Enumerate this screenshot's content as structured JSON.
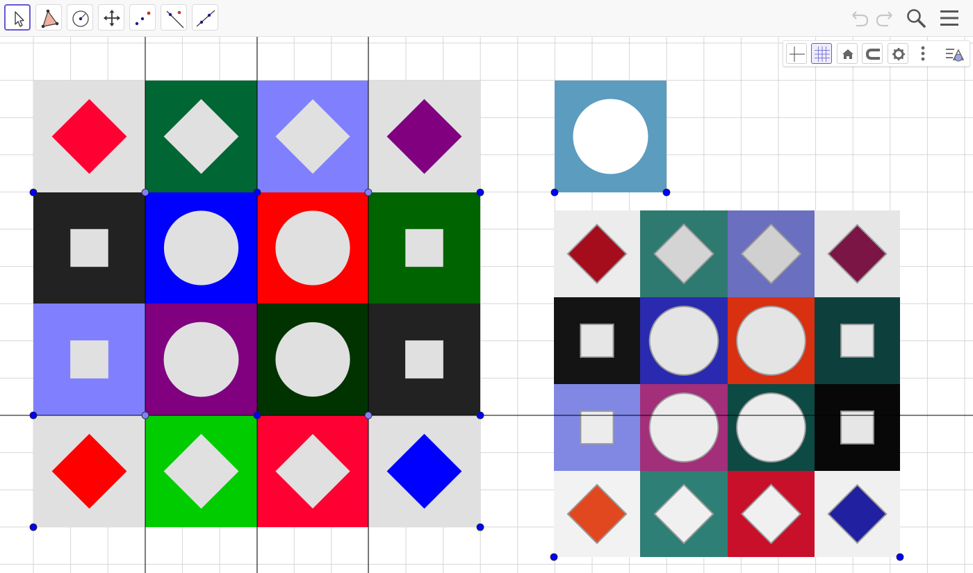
{
  "toolbar": {
    "tools": [
      {
        "icon": "move-arrow-icon",
        "selected": true
      },
      {
        "icon": "polygon-icon"
      },
      {
        "icon": "circle-center-point-icon"
      },
      {
        "icon": "move-graphics-view-icon"
      },
      {
        "icon": "point-icon"
      },
      {
        "icon": "perpendicular-line-icon"
      },
      {
        "icon": "line-icon"
      }
    ],
    "right_icons": [
      "undo-icon",
      "redo-icon",
      "search-icon",
      "menu-icon"
    ]
  },
  "style_bar": {
    "buttons": [
      "axes-toggle-icon",
      "grid-toggle-icon",
      "home-view-icon",
      "point-capturing-icon",
      "settings-gear-icon",
      "more-vertical-icon",
      "style-bar-toggle-icon"
    ],
    "grid_active": true
  },
  "colors": {
    "light_gray": "#e0e0e0",
    "dark_green": "#006633",
    "periwinkle": "#8080ff",
    "crimson": "#ff0033",
    "purple": "#800080",
    "black": "#222222",
    "blue": "#0000ff",
    "red": "#ff0000",
    "green": "#006400",
    "deep_green": "#003300",
    "lime": "#00cc00",
    "steel_blue": "#5b9cbf",
    "point_blue": "#0000ff",
    "point_periwinkle": "#8080ff"
  },
  "tile_grid": [
    [
      {
        "bg": "#e0e0e0",
        "shape": "diamond",
        "fill": "#ff0033"
      },
      {
        "bg": "#006633",
        "shape": "diamond",
        "fill": "#e0e0e0"
      },
      {
        "bg": "#8080ff",
        "shape": "diamond",
        "fill": "#e0e0e0"
      },
      {
        "bg": "#e0e0e0",
        "shape": "diamond",
        "fill": "#800080"
      }
    ],
    [
      {
        "bg": "#222222",
        "shape": "square",
        "fill": "#e0e0e0"
      },
      {
        "bg": "#0000ff",
        "shape": "circle",
        "fill": "#e0e0e0"
      },
      {
        "bg": "#ff0000",
        "shape": "circle",
        "fill": "#e0e0e0"
      },
      {
        "bg": "#006400",
        "shape": "square",
        "fill": "#e0e0e0"
      }
    ],
    [
      {
        "bg": "#8080ff",
        "shape": "square",
        "fill": "#e0e0e0"
      },
      {
        "bg": "#800080",
        "shape": "circle",
        "fill": "#e0e0e0"
      },
      {
        "bg": "#003300",
        "shape": "circle",
        "fill": "#e0e0e0"
      },
      {
        "bg": "#222222",
        "shape": "square",
        "fill": "#e0e0e0"
      }
    ],
    [
      {
        "bg": "#e0e0e0",
        "shape": "diamond",
        "fill": "#ff0000"
      },
      {
        "bg": "#00cc00",
        "shape": "diamond",
        "fill": "#e0e0e0"
      },
      {
        "bg": "#ff0033",
        "shape": "diamond",
        "fill": "#e0e0e0"
      },
      {
        "bg": "#e0e0e0",
        "shape": "diamond",
        "fill": "#0000ff"
      }
    ]
  ],
  "single_tile": {
    "bg": "#5b9cbf",
    "shape": "circle",
    "fill": "#ffffff"
  },
  "photo_grid": [
    [
      {
        "bg": "#ececec",
        "shape": "diamond",
        "fill": "#a50d1c"
      },
      {
        "bg": "#2e7a70",
        "shape": "diamond",
        "fill": "#d4d4d4"
      },
      {
        "bg": "#6b6fbf",
        "shape": "diamond",
        "fill": "#d0d0d0"
      },
      {
        "bg": "#e6e6e6",
        "shape": "diamond",
        "fill": "#7a1545"
      }
    ],
    [
      {
        "bg": "#141414",
        "shape": "square",
        "fill": "#e6e6e6"
      },
      {
        "bg": "#2a2ab0",
        "shape": "circle",
        "fill": "#e4e4e4"
      },
      {
        "bg": "#d83010",
        "shape": "circle",
        "fill": "#e4e4e4"
      },
      {
        "bg": "#0d403c",
        "shape": "square",
        "fill": "#e6e6e6"
      }
    ],
    [
      {
        "bg": "#8088e4",
        "shape": "square",
        "fill": "#ececec"
      },
      {
        "bg": "#a32e7a",
        "shape": "circle",
        "fill": "#ececec"
      },
      {
        "bg": "#0e4a44",
        "shape": "circle",
        "fill": "#ececec"
      },
      {
        "bg": "#080808",
        "shape": "square",
        "fill": "#e6e6e6"
      }
    ],
    [
      {
        "bg": "#f2f2f2",
        "shape": "diamond",
        "fill": "#e24820"
      },
      {
        "bg": "#2e7f76",
        "shape": "diamond",
        "fill": "#f0f0f0"
      },
      {
        "bg": "#c8102a",
        "shape": "diamond",
        "fill": "#f0f0f0"
      },
      {
        "bg": "#f0f0f0",
        "shape": "diamond",
        "fill": "#2020a0"
      }
    ]
  ]
}
